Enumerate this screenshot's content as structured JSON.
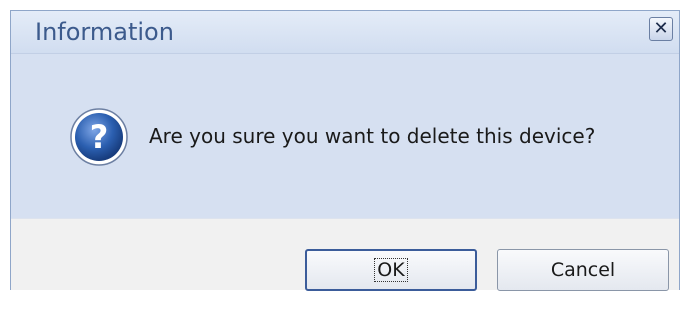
{
  "dialog": {
    "title": "Information",
    "close_icon": "close-icon",
    "icon": "question-icon",
    "message": "Are you sure you want to delete this device?",
    "buttons": {
      "ok_label": "OK",
      "cancel_label": "Cancel"
    },
    "colors": {
      "title_text": "#3c5a8c",
      "body_background": "#d6e0f1",
      "button_bar_background": "#f1f1f1",
      "icon_blue": "#2b5fb0"
    }
  }
}
